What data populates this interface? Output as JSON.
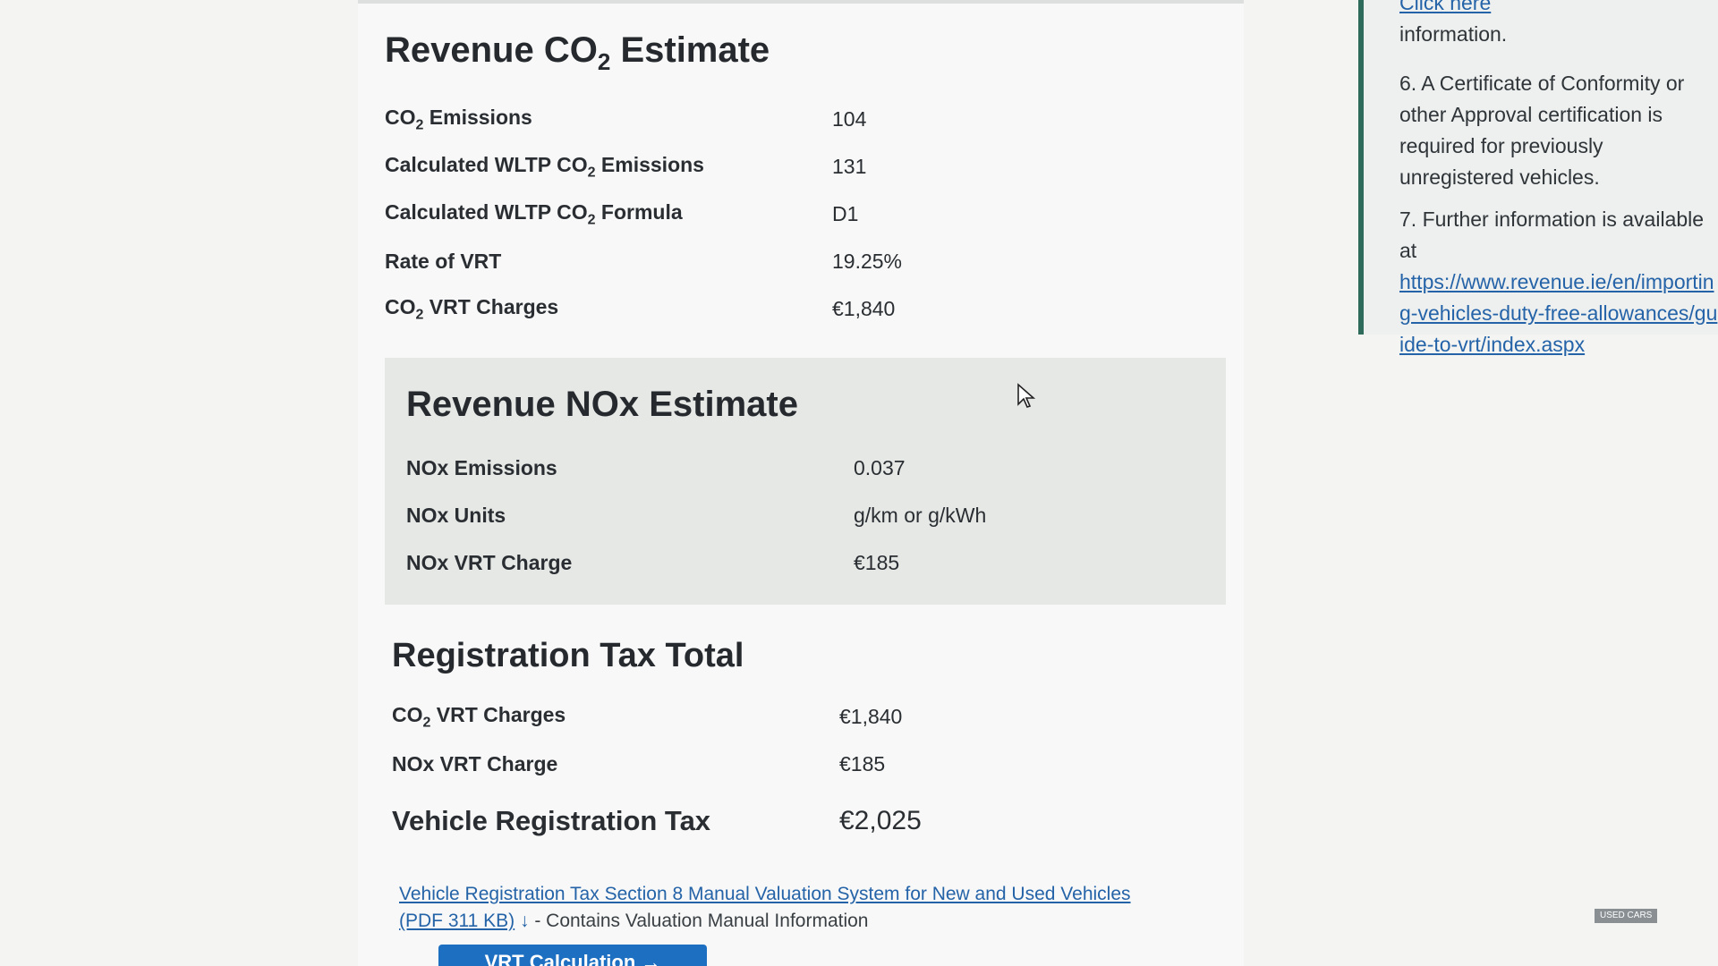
{
  "co2": {
    "title_pre": "Revenue CO",
    "title_sub": "2",
    "title_post": " Estimate",
    "rows": [
      {
        "label_pre": "CO",
        "label_sub": "2",
        "label_post": " Emissions",
        "value": "104"
      },
      {
        "label_pre": "Calculated WLTP CO",
        "label_sub": "2",
        "label_post": " Emissions",
        "value": "131"
      },
      {
        "label_pre": "Calculated WLTP CO",
        "label_sub": "2",
        "label_post": " Formula",
        "value": "D1"
      },
      {
        "label_pre": "Rate of VRT",
        "label_sub": "",
        "label_post": "",
        "value": "19.25%"
      },
      {
        "label_pre": "CO",
        "label_sub": "2",
        "label_post": " VRT Charges",
        "value": "€1,840"
      }
    ]
  },
  "nox": {
    "title": "Revenue NOx Estimate",
    "rows": [
      {
        "label": "NOx Emissions",
        "value": "0.037"
      },
      {
        "label": "NOx Units",
        "value": "g/km or g/kWh"
      },
      {
        "label": "NOx VRT Charge",
        "value": "€185"
      }
    ]
  },
  "total": {
    "title": "Registration Tax Total",
    "co2_label_pre": "CO",
    "co2_label_sub": "2",
    "co2_label_post": " VRT Charges",
    "co2_value": "€1,840",
    "nox_label": "NOx VRT Charge",
    "nox_value": "€185",
    "grand_label": "Vehicle Registration Tax",
    "grand_value": "€2,025"
  },
  "manual_link": {
    "text": "Vehicle Registration Tax Section 8 Manual Valuation System for New and Used Vehicles",
    "size": "(PDF 311 KB)",
    "icon": "download-arrow-icon",
    "suffix": " - Contains Valuation Manual Information"
  },
  "cta": {
    "label": "VRT Calculation →"
  },
  "side": {
    "fragment_link": "Click here",
    "fragment_text": "information.",
    "item6": "6. A Certificate of Conformity or other Approval certification is required for previously unregistered vehicles.",
    "item7_text": "7. Further information is available at",
    "item7_link": "https://www.revenue.ie/en/importing-vehicles-duty-free-allowances/guide-to-vrt/index.aspx"
  },
  "badge": "USED CARS"
}
